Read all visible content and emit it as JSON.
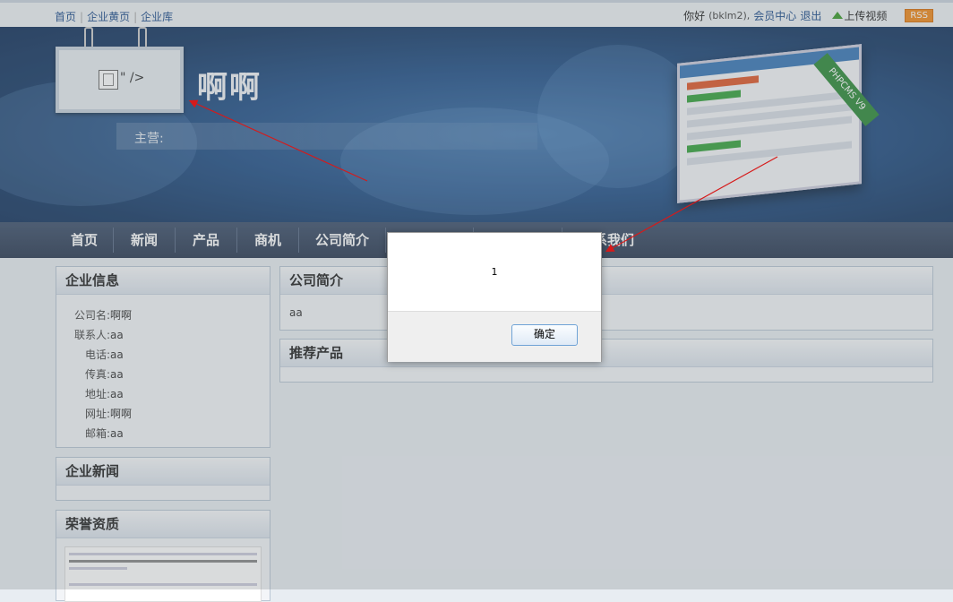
{
  "topbar": {
    "links": [
      "首页",
      "企业黄页",
      "企业库"
    ],
    "greeting": "你好",
    "username": "(bklm2),",
    "member_center": "会员中心",
    "logout": "退出",
    "upload_video": "上传视频",
    "rss": "RSS"
  },
  "banner": {
    "sign_text": "\" />",
    "company_name": "啊啊",
    "main_business_label": "主营:",
    "ribbon_text": "PHPCMS V9"
  },
  "nav": {
    "items": [
      "首页",
      "新闻",
      "产品",
      "商机",
      "公司简介",
      "联系我们"
    ]
  },
  "sidebar": {
    "company_info": {
      "title": "企业信息",
      "rows": [
        {
          "label": "公司名:",
          "value": "啊啊"
        },
        {
          "label": "联系人:",
          "value": "aa"
        },
        {
          "label": "电话:",
          "value": "aa"
        },
        {
          "label": "传真:",
          "value": "aa"
        },
        {
          "label": "地址:",
          "value": "aa"
        },
        {
          "label": "网址:",
          "value": "啊啊"
        },
        {
          "label": "邮箱:",
          "value": "aa"
        }
      ]
    },
    "company_news": {
      "title": "企业新闻"
    },
    "honors": {
      "title": "荣誉资质"
    }
  },
  "main": {
    "intro": {
      "title": "公司简介",
      "text": "aa"
    },
    "products": {
      "title": "推荐产品"
    }
  },
  "dialog": {
    "message": "1",
    "ok_label": "确定"
  },
  "colors": {
    "nav_bg": "#2f3f58",
    "banner_bg": "#23528a",
    "annotation_arrow": "#d61a1a"
  }
}
